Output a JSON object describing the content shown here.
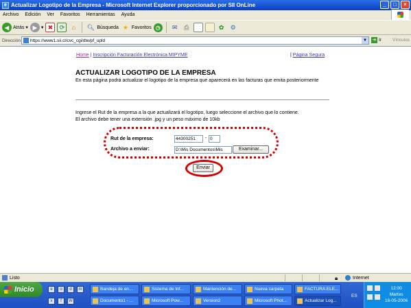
{
  "window": {
    "title": "Actualizar Logotipo de la Empresa - Microsoft Internet Explorer proporcionado por SII OnLine",
    "buttons": [
      "_",
      "□",
      "×"
    ]
  },
  "menu": [
    "Archivo",
    "Edición",
    "Ver",
    "Favoritos",
    "Herramientas",
    "Ayuda"
  ],
  "toolbar": {
    "back_label": "Atrás",
    "search_label": "Búsqueda",
    "favorites_label": "Favoritos"
  },
  "address": {
    "label": "Dirección",
    "url": "https://www1.sii.cl/cvc_cgi/dte/pf_upld",
    "go_label": "Ir",
    "links_label": "Vínculos"
  },
  "page": {
    "nav": {
      "home": "Home",
      "sep": "|",
      "inscripcion": "Inscripción Facturación Electrónica MIPYME",
      "right_sep": "|",
      "segura": "Página Segura"
    },
    "title": "ACTUALIZAR LOGOTIPO DE LA EMPRESA",
    "intro": "En esta página podrá actualizar el logotipo de la empresa que aparecerá en las facturas que emita posteriormente",
    "instr_line1": "Ingrese el Rut de la empresa a la que actualizará el logotipo, luego seleccione el archivo que lo contiene.",
    "instr_line2": "El archivo debe tener una extensión .jpg y un peso máximo de 10kb",
    "form": {
      "rut_label": "Rut de la empresa:",
      "rut_value": "44300251",
      "rut_dash": "-",
      "dv_value": "0",
      "file_label": "Archivo a enviar:",
      "file_value": "D:\\Mis Documentos\\Mis",
      "browse_label": "Examinar...",
      "submit_label": "Enviar"
    }
  },
  "status": {
    "left": "Listo",
    "zone": "Internet"
  },
  "taskbar": {
    "start": "Inicio",
    "tasks_row1": [
      "Bandeja de en...",
      "Sistema de Inf...",
      "Mantención de...",
      "Nueva carpeta",
      "FACTURA ELE..."
    ],
    "tasks_row2": [
      "Documento1 - ...",
      "Microsoft Pow...",
      "Version2",
      "Microsoft Phot...",
      "Actualizar Log..."
    ],
    "lang": "ES",
    "clock_time": "12:00",
    "clock_day": "Martes",
    "clock_date": "16-05-2006"
  },
  "colors": {
    "highlight_red": "#d40000",
    "titlebar_blue": "#0a3fbf",
    "taskbar_blue": "#1f50c2"
  }
}
